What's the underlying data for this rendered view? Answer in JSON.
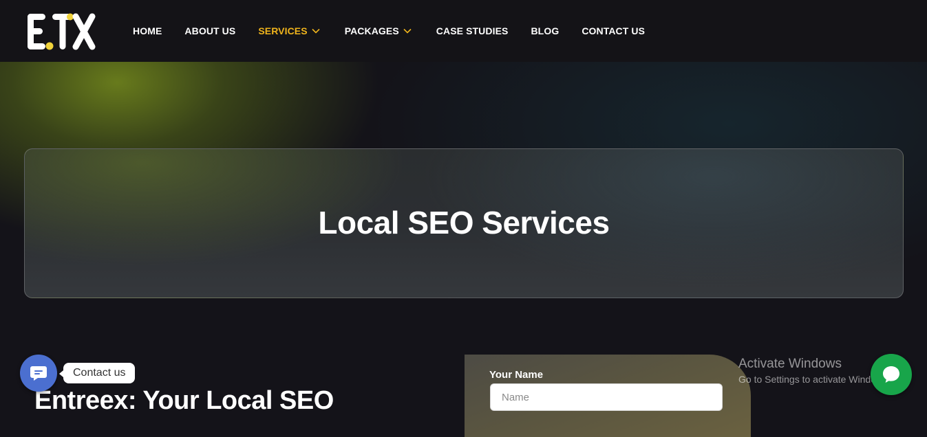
{
  "header": {
    "logo_text": "ETX",
    "nav": [
      {
        "label": "HOME",
        "active": false,
        "has_dropdown": false
      },
      {
        "label": "ABOUT US",
        "active": false,
        "has_dropdown": false
      },
      {
        "label": "SERVICES",
        "active": true,
        "has_dropdown": true
      },
      {
        "label": "PACKAGES",
        "active": false,
        "has_dropdown": true
      },
      {
        "label": "CASE STUDIES",
        "active": false,
        "has_dropdown": false
      },
      {
        "label": "BLOG",
        "active": false,
        "has_dropdown": false
      },
      {
        "label": "CONTACT US",
        "active": false,
        "has_dropdown": false
      }
    ]
  },
  "hero": {
    "title": "Local SEO Services"
  },
  "intro": {
    "heading": "Entreex: Your Local SEO"
  },
  "form": {
    "name_label": "Your Name",
    "name_placeholder": "Name",
    "name_value": ""
  },
  "contact_widget": {
    "tooltip": "Contact us",
    "icon": "chat-bubble-icon"
  },
  "windows_watermark": {
    "title": "Activate Windows",
    "subtitle": "Go to Settings to activate Windows."
  },
  "chat_button": {
    "icon": "message-icon"
  },
  "colors": {
    "background": "#141319",
    "accent": "#f0b41c",
    "contact_blue": "#4b6fd0",
    "chat_green": "#18a54a"
  }
}
